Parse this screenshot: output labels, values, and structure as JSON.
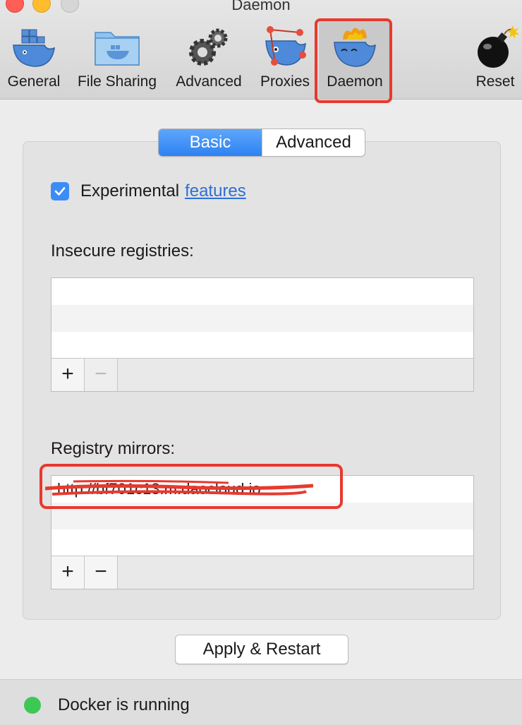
{
  "window": {
    "title": "Daemon"
  },
  "toolbar": {
    "items": [
      {
        "label": "General",
        "icon": "docker-whale-icon"
      },
      {
        "label": "File Sharing",
        "icon": "folder-whale-icon"
      },
      {
        "label": "Advanced",
        "icon": "gears-icon"
      },
      {
        "label": "Proxies",
        "icon": "network-whale-icon"
      },
      {
        "label": "Daemon",
        "icon": "flame-whale-icon",
        "selected": true
      },
      {
        "label": "Reset",
        "icon": "bomb-icon"
      }
    ]
  },
  "tabs": {
    "basic": "Basic",
    "advanced": "Advanced",
    "active": "Basic"
  },
  "experimental": {
    "label": "Experimental",
    "link": "features",
    "checked": true
  },
  "insecure_registries": {
    "label": "Insecure registries:",
    "entries": []
  },
  "registry_mirrors": {
    "label": "Registry mirrors:",
    "entries": [
      "http://bf701c13.m.daocloud.io"
    ]
  },
  "buttons": {
    "add": "+",
    "remove": "−",
    "apply": "Apply & Restart"
  },
  "status": {
    "text": "Docker is running",
    "color": "#3dc856"
  },
  "colors": {
    "accent": "#2d82f2",
    "annotation": "#e8392e",
    "link": "#2d6fd6"
  }
}
